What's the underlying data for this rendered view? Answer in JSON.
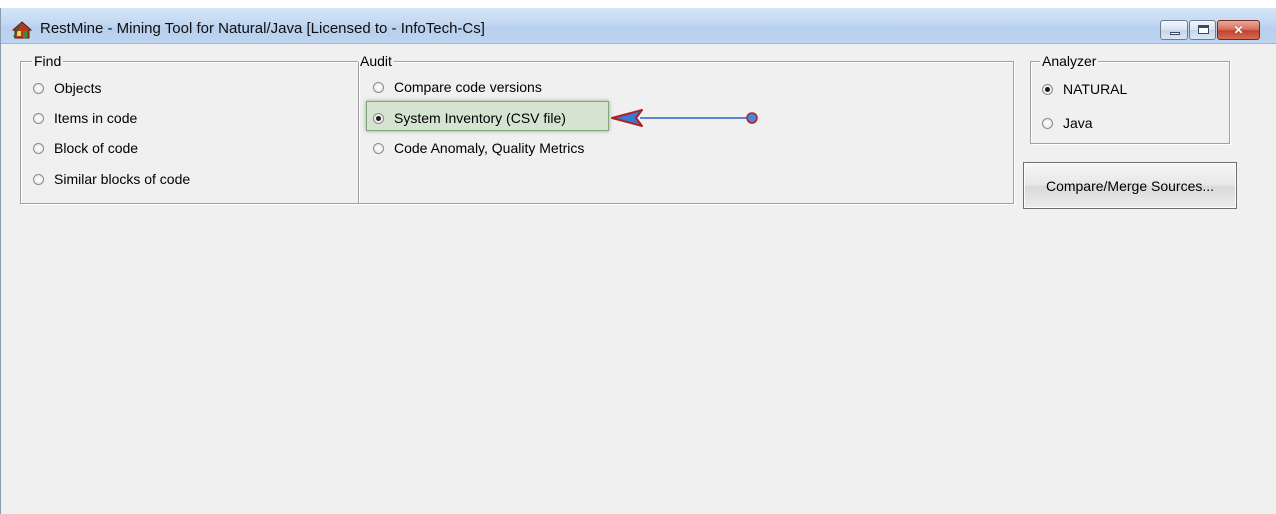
{
  "window": {
    "title": "RestMine - Mining Tool for Natural/Java [Licensed to  - InfoTech-Cs]",
    "app_icon": "restmine-app-icon",
    "controls": {
      "minimize": "minimize-icon",
      "maximize": "maximize-icon",
      "close": "close-icon"
    }
  },
  "find": {
    "label": "Find",
    "options": [
      {
        "label": "Objects",
        "selected": false
      },
      {
        "label": "Items in code",
        "selected": false
      },
      {
        "label": "Block of code",
        "selected": false
      },
      {
        "label": "Similar blocks of code",
        "selected": false
      }
    ]
  },
  "audit": {
    "label": "Audit",
    "options": [
      {
        "label": "Compare code versions",
        "selected": false
      },
      {
        "label": "System Inventory (CSV file)",
        "selected": true
      },
      {
        "label": "Code Anomaly, Quality Metrics",
        "selected": false
      }
    ]
  },
  "analyzer": {
    "label": "Analyzer",
    "options": [
      {
        "label": "NATURAL",
        "selected": true
      },
      {
        "label": "Java",
        "selected": false
      }
    ]
  },
  "buttons": {
    "compare_merge": "Compare/Merge Sources..."
  },
  "colors": {
    "highlight_fill": "#d5e3d1",
    "arrow_outline": "#b02020",
    "arrow_fill": "#3a78d8",
    "arrow_line": "#2a62c8"
  }
}
